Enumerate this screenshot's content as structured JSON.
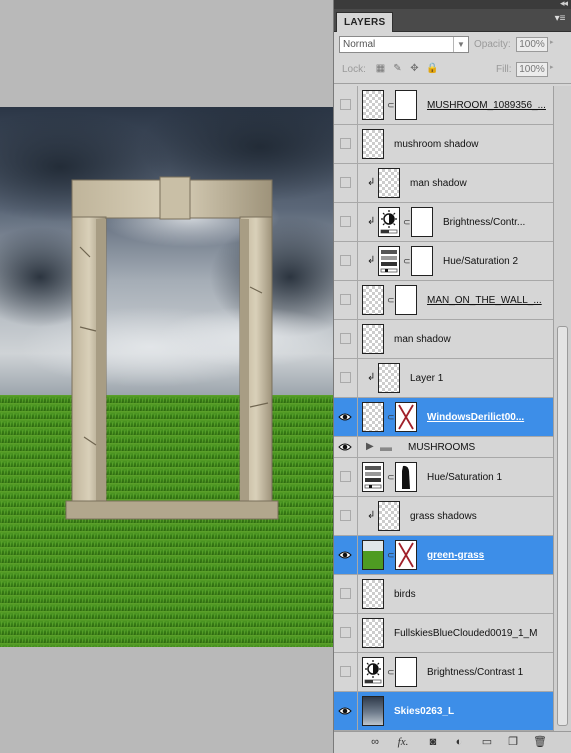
{
  "panel": {
    "tab": "LAYERS",
    "blend_mode": "Normal",
    "opacity_label": "Opacity:",
    "opacity_value": "100%",
    "lock_label": "Lock:",
    "fill_label": "Fill:",
    "fill_value": "100%"
  },
  "layers": [
    {
      "name": "MUSHROOM_1089356_...",
      "visible": false,
      "underline": true,
      "clipped": false,
      "thumb": "checker",
      "mask": true,
      "selected": false
    },
    {
      "name": "mushroom shadow",
      "visible": false,
      "underline": false,
      "clipped": false,
      "thumb": "checker",
      "mask": false,
      "selected": false
    },
    {
      "name": "man shadow",
      "visible": false,
      "underline": false,
      "clipped": true,
      "thumb": "checker",
      "mask": false,
      "selected": false
    },
    {
      "name": "Brightness/Contr...",
      "visible": false,
      "underline": false,
      "clipped": true,
      "thumb": "brightness",
      "mask": true,
      "selected": false
    },
    {
      "name": "Hue/Saturation 2",
      "visible": false,
      "underline": false,
      "clipped": true,
      "thumb": "huesat",
      "mask": true,
      "selected": false
    },
    {
      "name": "MAN_ON_THE_WALL_...",
      "visible": false,
      "underline": true,
      "clipped": false,
      "thumb": "checker",
      "mask": true,
      "selected": false
    },
    {
      "name": "man shadow",
      "visible": false,
      "underline": false,
      "clipped": false,
      "thumb": "checker",
      "mask": false,
      "selected": false
    },
    {
      "name": "Layer 1",
      "visible": false,
      "underline": false,
      "clipped": true,
      "thumb": "checker",
      "mask": false,
      "selected": false
    },
    {
      "name": "WindowsDerilict00...",
      "visible": true,
      "underline": true,
      "clipped": false,
      "thumb": "checker",
      "mask": "x",
      "selected": true
    },
    {
      "name": "MUSHROOMS",
      "visible": true,
      "underline": false,
      "clipped": false,
      "thumb": "folder",
      "mask": false,
      "selected": false,
      "group": true
    },
    {
      "name": "Hue/Saturation 1",
      "visible": false,
      "underline": false,
      "clipped": false,
      "thumb": "huesat",
      "mask": "black",
      "selected": false
    },
    {
      "name": "grass shadows",
      "visible": false,
      "underline": false,
      "clipped": true,
      "thumb": "checker",
      "mask": false,
      "selected": false
    },
    {
      "name": "green-grass",
      "visible": true,
      "underline": true,
      "clipped": false,
      "thumb": "grass",
      "mask": "x",
      "selected": true
    },
    {
      "name": "birds",
      "visible": false,
      "underline": false,
      "clipped": false,
      "thumb": "checker",
      "mask": false,
      "selected": false
    },
    {
      "name": "FullskiesBlueClouded0019_1_M",
      "visible": false,
      "underline": false,
      "clipped": false,
      "thumb": "checker",
      "mask": false,
      "selected": false
    },
    {
      "name": "Brightness/Contrast 1",
      "visible": false,
      "underline": false,
      "clipped": false,
      "thumb": "brightness",
      "mask": true,
      "selected": false
    },
    {
      "name": "Skies0263_L",
      "visible": true,
      "underline": false,
      "clipped": false,
      "thumb": "sky",
      "mask": false,
      "selected": true
    }
  ],
  "footer_icons": [
    "link-layers-icon",
    "fx-icon",
    "add-mask-icon",
    "adjustment-icon",
    "new-group-icon",
    "new-layer-icon",
    "trash-icon"
  ]
}
